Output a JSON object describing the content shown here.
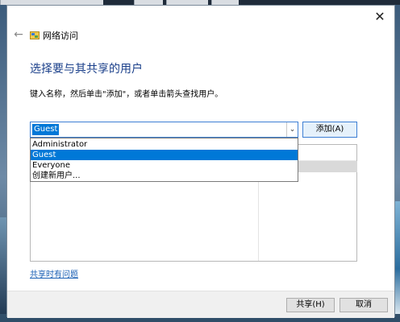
{
  "window": {
    "title": "网络访问",
    "close_glyph": "✕",
    "back_glyph": "←"
  },
  "content": {
    "heading": "选择要与其共享的用户",
    "instruction": "键入名称，然后单击\"添加\"，或者单击箭头查找用户。"
  },
  "combo": {
    "value": "Guest",
    "arrow_glyph": "⌄"
  },
  "dropdown": {
    "options": [
      "Administrator",
      "Guest",
      "Everyone",
      "创建新用户..."
    ],
    "selected": "Guest"
  },
  "buttons": {
    "add": "添加(A)",
    "share": "共享(H)",
    "cancel": "取消"
  },
  "links": {
    "help": "共享时有问题"
  },
  "icons": {
    "app": "network-share-icon",
    "close": "close-icon",
    "back": "back-arrow-icon",
    "dropdown": "chevron-down-icon"
  },
  "colors": {
    "heading": "#1a3f8a",
    "accent": "#0078d7",
    "link": "#1a5fb4"
  }
}
